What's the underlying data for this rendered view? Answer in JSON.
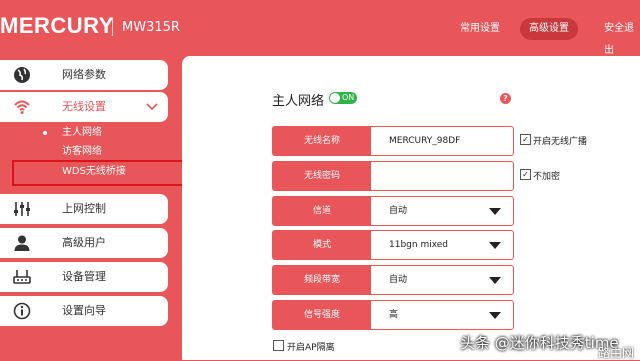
{
  "header": {
    "logo": "MERCURY",
    "model": "MW315R",
    "nav": [
      "常用设置",
      "高级设置",
      "安全退出"
    ],
    "active_nav": "高级设置"
  },
  "sidebar": {
    "items": [
      {
        "label": "网络参数",
        "icon": "globe-icon"
      },
      {
        "label": "无线设置",
        "icon": "wifi-icon",
        "expanded": true
      },
      {
        "label": "上网控制",
        "icon": "sliders-icon"
      },
      {
        "label": "高级用户",
        "icon": "user-icon"
      },
      {
        "label": "设备管理",
        "icon": "router-icon"
      },
      {
        "label": "设置向导",
        "icon": "info-icon"
      }
    ],
    "subitems": [
      "主人网络",
      "访客网络",
      "WDS无线桥接"
    ]
  },
  "main": {
    "title": "主人网络",
    "toggle": "ON",
    "help": "?",
    "fields": [
      {
        "label": "无线名称",
        "value": "MERCURY_98DF"
      },
      {
        "label": "无线密码",
        "value": ""
      },
      {
        "label": "信道",
        "value": "自动"
      },
      {
        "label": "模式",
        "value": "11bgn mixed"
      },
      {
        "label": "频段带宽",
        "value": "自动"
      },
      {
        "label": "信号强度",
        "value": "高"
      }
    ],
    "check_broadcast": "开启无线广播",
    "check_nopass": "不加密",
    "check_ap_isolation": "开启AP隔离"
  },
  "watermark": "头条 @迷你科技秀time",
  "watermark2": "路由网",
  "colors": {
    "brand": "#e9565a",
    "highlight": "#d9141b",
    "toggle_on": "#2fb44a"
  }
}
